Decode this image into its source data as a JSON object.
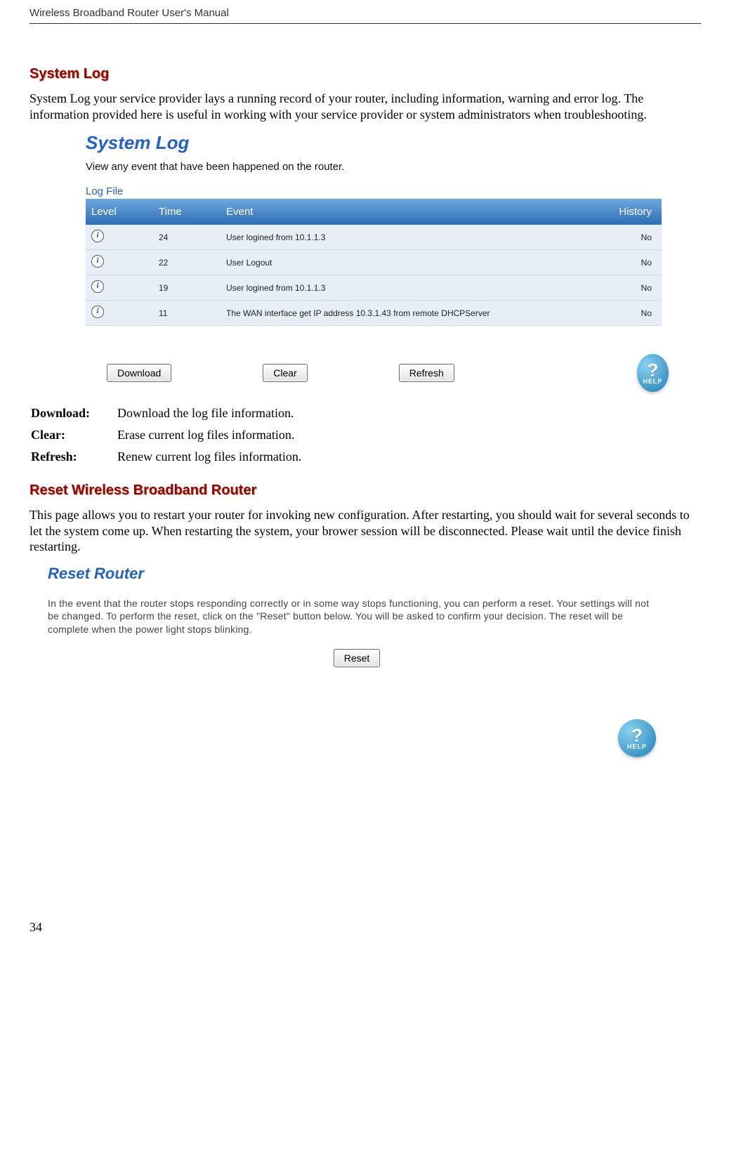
{
  "doc_title": "Wireless Broadband Router User's Manual",
  "page_number": "34",
  "syslog": {
    "heading": "System Log",
    "intro": "System Log your service provider lays a running record of your router, including information, warning and error log. The information provided here is useful in working with your service provider or system administrators when troubleshooting.",
    "shot": {
      "title": "System Log",
      "subtitle": "View any event that have been happened on the router.",
      "section_label": "Log File",
      "columns": {
        "c0": "Level",
        "c1": "Time",
        "c2": "Event",
        "c3": "History"
      },
      "rows": [
        {
          "time": "24",
          "event": "User logined from 10.1.1.3",
          "history": "No"
        },
        {
          "time": "22",
          "event": "User Logout",
          "history": "No"
        },
        {
          "time": "19",
          "event": "User logined from 10.1.1.3",
          "history": "No"
        },
        {
          "time": "11",
          "event": "The WAN interface get IP address 10.3.1.43 from remote DHCPServer",
          "history": "No"
        }
      ],
      "buttons": {
        "download": "Download",
        "clear": "Clear",
        "refresh": "Refresh"
      },
      "help_q": "?",
      "help_label": "HELP"
    },
    "defs": {
      "download_k": "Download:",
      "download_v": "Download the log file information.",
      "clear_k": "Clear:",
      "clear_v": "Erase current log files information.",
      "refresh_k": "Refresh:",
      "refresh_v": "Renew current log files information."
    }
  },
  "reset": {
    "heading": "Reset Wireless Broadband Router",
    "intro": "This page allows you to restart your router for invoking new configuration. After restarting, you should wait for several seconds to let the system come up. When restarting the system, your brower session will be disconnected. Please wait until the device finish restarting.",
    "shot": {
      "title": "Reset Router",
      "desc": "In the event that the router stops responding correctly or in some way stops functioning, you can perform a reset.  Your settings will not be changed.  To perform the reset, click on the \"Reset\" button below.  You will be asked to confirm your decision.  The reset will be complete when the power light stops blinking.",
      "button": "Reset",
      "help_q": "?",
      "help_label": "HELP"
    }
  }
}
